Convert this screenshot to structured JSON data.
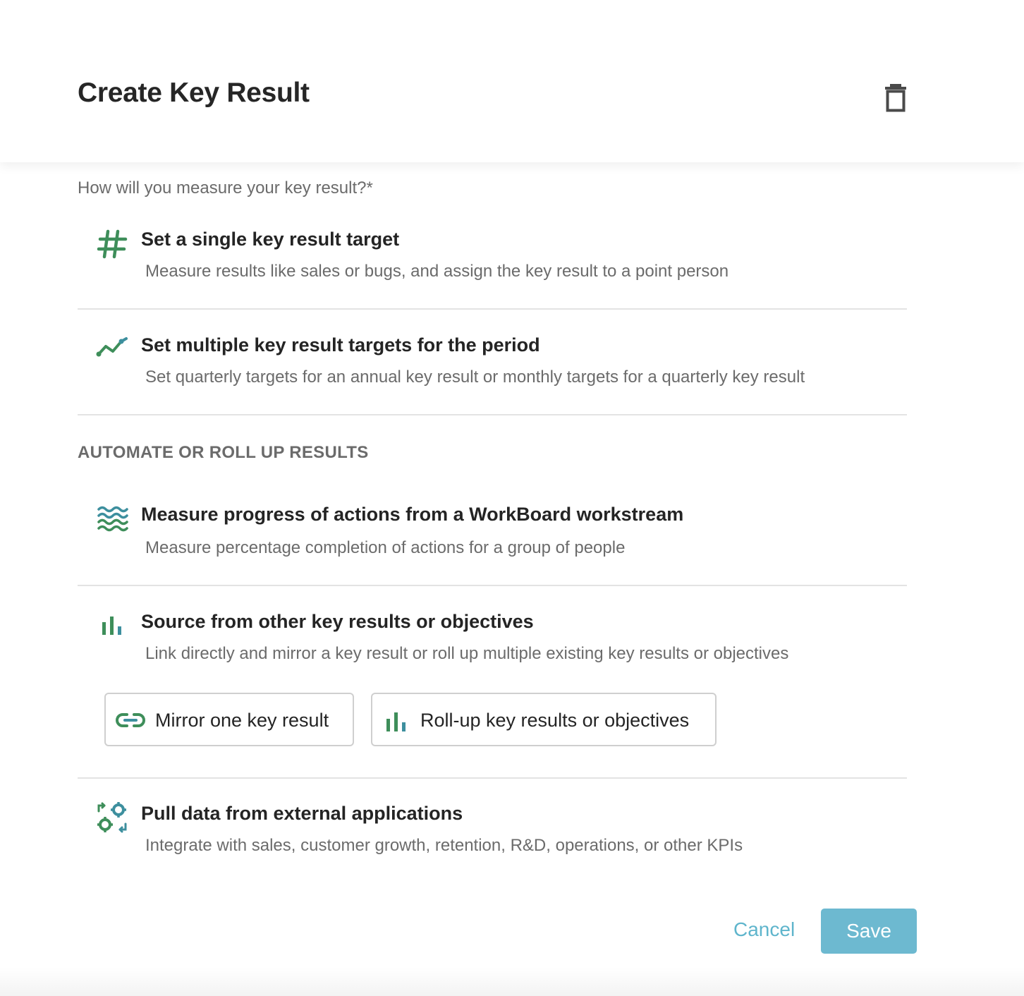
{
  "header": {
    "title": "Create Key Result",
    "delete_icon": "trash-icon"
  },
  "measure": {
    "question": "How will you measure your key result?*",
    "options": [
      {
        "icon": "hash-icon",
        "title": "Set a single key result target",
        "description": "Measure results like sales or bugs, and assign the key result to a point person"
      },
      {
        "icon": "trend-line-icon",
        "title": "Set multiple key result targets for the period",
        "description": "Set quarterly targets for an annual key result or monthly targets for a quarterly key result"
      }
    ]
  },
  "automate": {
    "heading": "AUTOMATE OR ROLL UP RESULTS",
    "options": [
      {
        "icon": "workstream-waves-icon",
        "title": "Measure progress of actions from a WorkBoard workstream",
        "description": "Measure percentage completion of actions for a group of people"
      },
      {
        "icon": "bar-chart-icon",
        "title": "Source from other key results or objectives",
        "description": "Link directly and mirror a key result or roll up multiple existing key results or objectives",
        "sub_buttons": [
          {
            "icon": "link-icon",
            "label": "Mirror one key result"
          },
          {
            "icon": "bar-chart-icon",
            "label": "Roll-up key results or objectives"
          }
        ]
      },
      {
        "icon": "integration-gears-icon",
        "title": "Pull data from external applications",
        "description": "Integrate with sales, customer growth, retention, R&D, operations, or other KPIs"
      }
    ]
  },
  "footer": {
    "cancel_label": "Cancel",
    "save_label": "Save"
  },
  "colors": {
    "icon_green": "#3e8e5a",
    "icon_teal": "#3d8f9e",
    "accent_blue": "#5fb5cc",
    "save_bg": "#6db9d0",
    "divider": "#e3e3e3"
  }
}
